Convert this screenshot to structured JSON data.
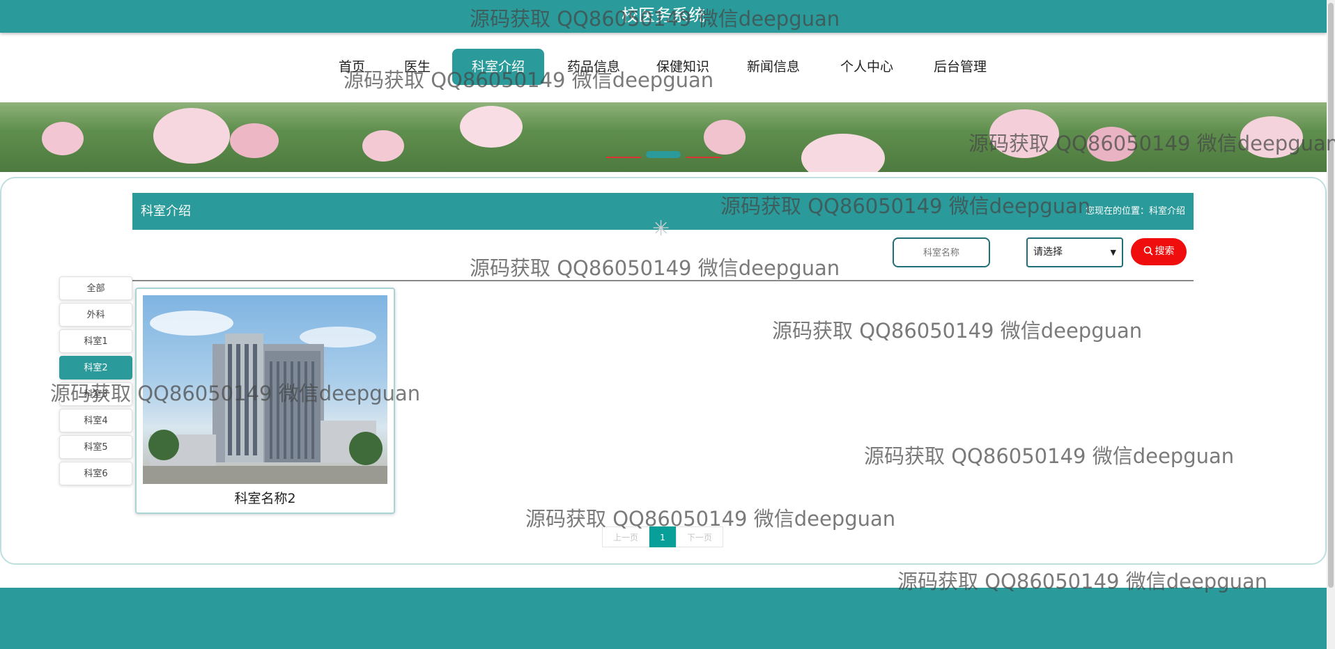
{
  "header": {
    "site_title": "校医务系统"
  },
  "nav": {
    "items": [
      {
        "label": "首页"
      },
      {
        "label": "医生"
      },
      {
        "label": "科室介绍"
      },
      {
        "label": "药品信息"
      },
      {
        "label": "保健知识"
      },
      {
        "label": "新闻信息"
      },
      {
        "label": "个人中心"
      },
      {
        "label": "后台管理"
      }
    ],
    "active_index": 2
  },
  "section": {
    "title": "科室介绍",
    "breadcrumb": "您现在的位置：科室介绍"
  },
  "search": {
    "input_placeholder": "科室名称",
    "select_value": "请选择",
    "button_label": "搜索"
  },
  "categories": {
    "items": [
      "全部",
      "外科",
      "科室1",
      "科室2",
      "科室3",
      "科室4",
      "科室5",
      "科室6"
    ],
    "active_index": 3
  },
  "cards": [
    {
      "title": "科室名称2"
    }
  ],
  "pagination": {
    "prev": "上一页",
    "current": "1",
    "next": "下一页"
  },
  "watermark": {
    "text": "源码获取 QQ86050149 微信deepguan"
  },
  "colors": {
    "primary": "#2a9a9a",
    "search_button": "#ef0d0d",
    "pager_active": "#079f98"
  }
}
